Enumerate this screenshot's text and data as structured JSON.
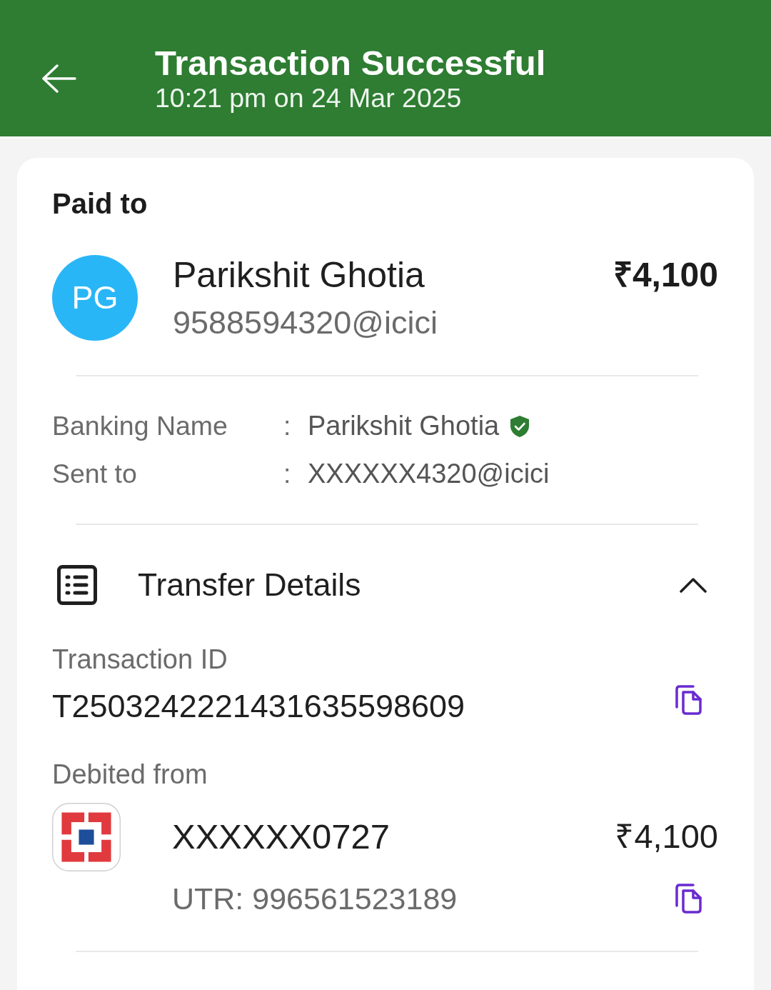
{
  "header": {
    "title": "Transaction Successful",
    "subtitle": "10:21 pm on 24 Mar 2025"
  },
  "paid_to": {
    "heading": "Paid to",
    "avatar_initials": "PG",
    "name": "Parikshit Ghotia",
    "upi_id": "9588594320@icici",
    "amount": "₹4,100"
  },
  "details": [
    {
      "label": "Banking Name",
      "separator": ":",
      "value": "Parikshit Ghotia",
      "verified": true
    },
    {
      "label": "Sent to",
      "separator": ":",
      "value": "XXXXXX4320@icici",
      "verified": false
    }
  ],
  "transfer_details": {
    "title": "Transfer Details",
    "expanded": true,
    "transaction_id": {
      "label": "Transaction ID",
      "value": "T2503242221431635598609"
    },
    "debited_from": {
      "label": "Debited from",
      "account": "XXXXXX0727",
      "amount": "₹4,100",
      "utr": "UTR: 996561523189"
    }
  }
}
